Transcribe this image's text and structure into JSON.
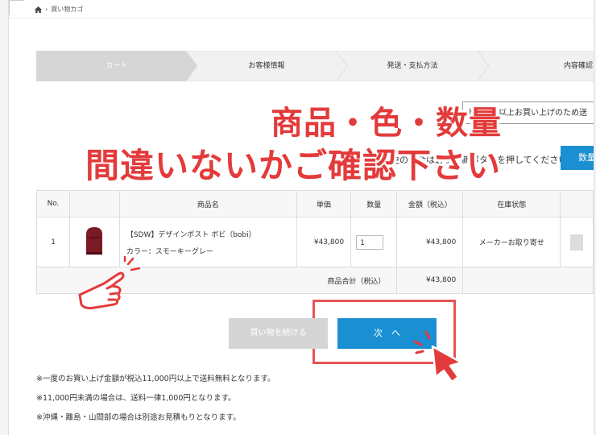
{
  "breadcrumb": {
    "home_icon": "home-icon",
    "current": "買い物カゴ"
  },
  "steps": [
    "カート",
    "お客様情報",
    "発送・支払方法",
    "内容確認"
  ],
  "overlay": {
    "line1": "商品・色・数量",
    "line2": "間違いないかご確認下さい"
  },
  "partial": {
    "select_text": "上記の円以上お買い上げのため送",
    "note_text": "確認・変更の場合は必ず更新ボタンを押してください。",
    "update_label": "数量"
  },
  "table": {
    "headers": [
      "No.",
      "",
      "商品名",
      "単価",
      "数量",
      "金額（税込）",
      "在庫状態",
      ""
    ],
    "rows": [
      {
        "no": "1",
        "name": "【SDW】デザインポスト ボビ（bobi）",
        "color": "カラー：スモーキーグレー",
        "unit_price": "¥43,800",
        "quantity": "1",
        "amount": "¥43,800",
        "stock": "メーカーお取り寄せ"
      }
    ],
    "total_label": "商品合計（税込）",
    "total_value": "¥43,800"
  },
  "buttons": {
    "continue": "買い物を続ける",
    "next": "次　へ"
  },
  "notes": [
    "※一度のお買い上げ金額が税込11,000円以上で送料無料となります。",
    "※11,000円未満の場合は、送料一律1,000円となります。",
    "※沖縄・離島・山間部の場合は別途お見積もりとなります。"
  ],
  "colors": {
    "accent": "#1a8fd1",
    "overlay_red": "#e33b3b",
    "step_active": "#d6d6d6"
  }
}
